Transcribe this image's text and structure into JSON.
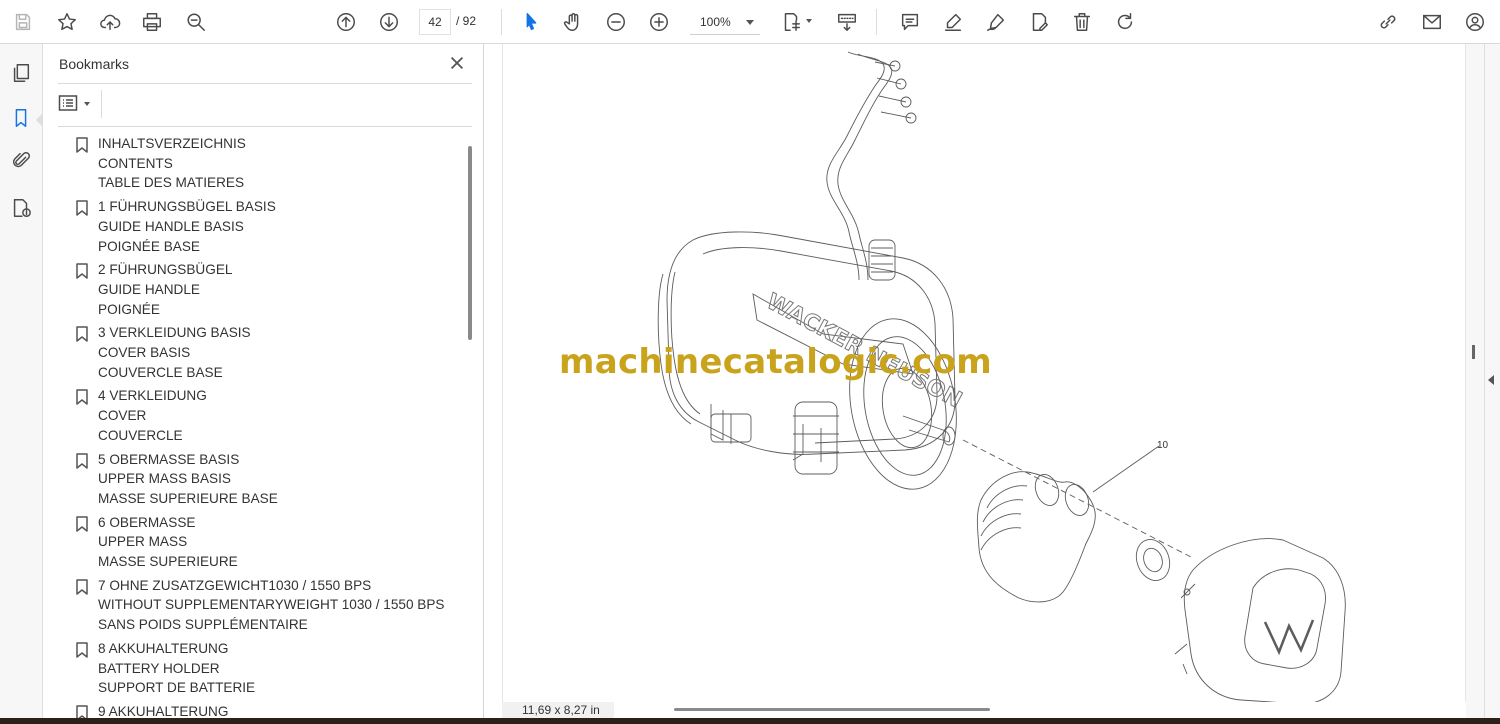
{
  "toolbar": {
    "page_current": "42",
    "page_total": "/ 92",
    "zoom": "100%",
    "icons": [
      "save-icon",
      "star-icon",
      "cloud-upload-icon",
      "print-icon",
      "find-icon",
      "page-up-icon",
      "page-down-icon",
      "select-cursor-icon",
      "hand-tool-icon",
      "zoom-out-icon",
      "zoom-in-icon",
      "page-fit-icon",
      "scroll-mode-icon",
      "comment-icon",
      "highlight-pen-icon",
      "draw-icon",
      "fill-sign-icon",
      "delete-icon",
      "rotate-icon",
      "share-link-icon",
      "email-icon",
      "account-icon"
    ]
  },
  "leftrail": {
    "icons": [
      "pages-icon",
      "bookmarks-icon",
      "attachments-icon",
      "document-info-icon"
    ]
  },
  "bookmarks": {
    "title": "Bookmarks",
    "items": [
      {
        "lines": [
          "INHALTSVERZEICHNIS",
          "CONTENTS",
          "TABLE DES MATIERES"
        ]
      },
      {
        "lines": [
          "1 FÜHRUNGSBÜGEL BASIS",
          "GUIDE HANDLE BASIS",
          "POIGNÉE BASE"
        ]
      },
      {
        "lines": [
          "2 FÜHRUNGSBÜGEL",
          "GUIDE HANDLE",
          "POIGNÉE"
        ]
      },
      {
        "lines": [
          "3 VERKLEIDUNG BASIS",
          "COVER BASIS",
          "COUVERCLE BASE"
        ]
      },
      {
        "lines": [
          "4 VERKLEIDUNG",
          "COVER",
          "COUVERCLE"
        ]
      },
      {
        "lines": [
          "5 OBERMASSE BASIS",
          "UPPER MASS BASIS",
          "MASSE SUPERIEURE BASE"
        ]
      },
      {
        "lines": [
          "6 OBERMASSE",
          "UPPER MASS",
          "MASSE SUPERIEURE"
        ]
      },
      {
        "lines": [
          "7 OHNE ZUSATZGEWICHT1030 / 1550 BPS",
          "WITHOUT SUPPLEMENTARYWEIGHT 1030 / 1550 BPS",
          "SANS POIDS SUPPLÉMENTAIRE"
        ]
      },
      {
        "lines": [
          "8 AKKUHALTERUNG",
          "BATTERY HOLDER",
          "SUPPORT DE BATTERIE"
        ]
      },
      {
        "lines": [
          "9 AKKUHALTERUNG"
        ]
      }
    ]
  },
  "document": {
    "watermark": "machinecatalogic.com",
    "callout_label": "10",
    "page_size": "11,69 x 8,27 in",
    "brand_casting_text": "WACKER NEUSON"
  },
  "colors": {
    "accent": "#1473e6",
    "watermark": "#c9a31c"
  }
}
